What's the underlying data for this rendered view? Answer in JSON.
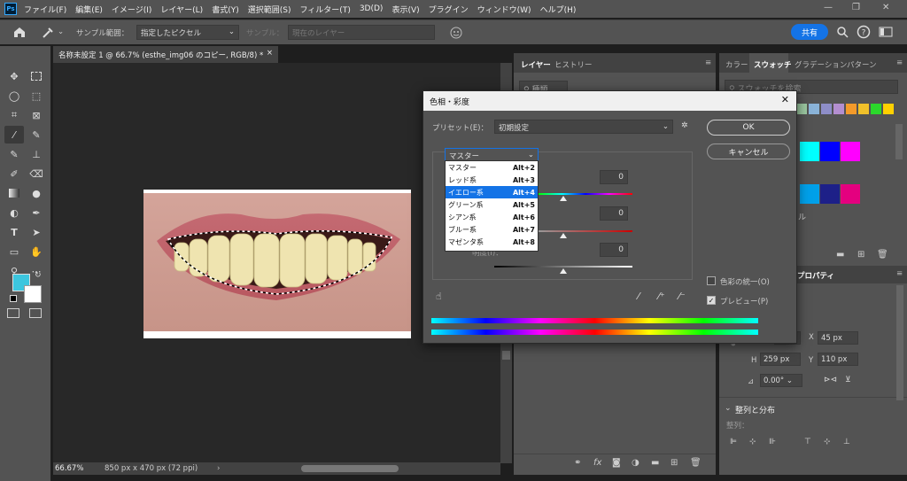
{
  "app": {
    "logo": "Ps"
  },
  "menu": [
    "ファイル(F)",
    "編集(E)",
    "イメージ(I)",
    "レイヤー(L)",
    "書式(Y)",
    "選択範囲(S)",
    "フィルター(T)",
    "3D(D)",
    "表示(V)",
    "プラグイン",
    "ウィンドウ(W)",
    "ヘルプ(H)"
  ],
  "window_controls": {
    "minimize": "—",
    "restore": "❐",
    "close": "✕"
  },
  "options": {
    "sample_range_label": "サンプル範囲：",
    "sample_range_value": "指定したピクセル",
    "sample_label": "サンプル：",
    "sample_value": "現在のレイヤー",
    "share": "共有"
  },
  "document": {
    "tab_title": "名称未設定 1 @ 66.7% (esthe_img06 のコピー, RGB/8) *",
    "tab_close": "×",
    "zoom": "66.67%",
    "dimensions": "850 px x 470 px (72 ppi)"
  },
  "layers_panel": {
    "tabs": [
      "レイヤー",
      "ヒストリー"
    ],
    "search_placeholder": "種類"
  },
  "swatches_panel": {
    "tabs": [
      "カラー",
      "スウォッチ",
      "グラデーション",
      "パターン"
    ],
    "search_placeholder": "スウォッチを検索",
    "row1": [
      "#9bc7a0",
      "#8ab3d8",
      "#8e8ec8",
      "#b38ed0",
      "#f39a2a",
      "#f0c02a",
      "#2bd82b",
      "#ffd000"
    ],
    "grid": [
      [
        "#00ffff",
        "#0000ff",
        "#ff00ff"
      ],
      [
        "#00a0e9",
        "#1d2088",
        "#e4007f"
      ]
    ],
    "char_fragment": "ル"
  },
  "properties_panel": {
    "title": "プロパティ",
    "w_label": "W",
    "x_label": "X",
    "x_value": "45 px",
    "h_label": "H",
    "h_value": "259 px",
    "y_label": "Y",
    "y_value": "110 px",
    "angle_value": "0.00°",
    "align_section": "整列と分布",
    "align_label": "整列："
  },
  "hue_sat_dialog": {
    "title": "色相・彩度",
    "preset_label": "プリセット(E)：",
    "preset_value": "初期設定",
    "channel_value": "マスター",
    "channels": [
      {
        "name": "マスター",
        "shortcut": "Alt+2"
      },
      {
        "name": "レッド系",
        "shortcut": "Alt+3"
      },
      {
        "name": "イエロー系",
        "shortcut": "Alt+4"
      },
      {
        "name": "グリーン系",
        "shortcut": "Alt+5"
      },
      {
        "name": "シアン系",
        "shortcut": "Alt+6"
      },
      {
        "name": "ブルー系",
        "shortcut": "Alt+7"
      },
      {
        "name": "マゼンタ系",
        "shortcut": "Alt+8"
      }
    ],
    "hue_value": "0",
    "saturation_value": "0",
    "lightness_label": "明度(I)：",
    "lightness_value": "0",
    "ok": "OK",
    "cancel": "キャンセル",
    "colorize_label": "色彩の統一(O)",
    "colorize_checked": false,
    "preview_label": "プレビュー(P)",
    "preview_checked": true
  }
}
